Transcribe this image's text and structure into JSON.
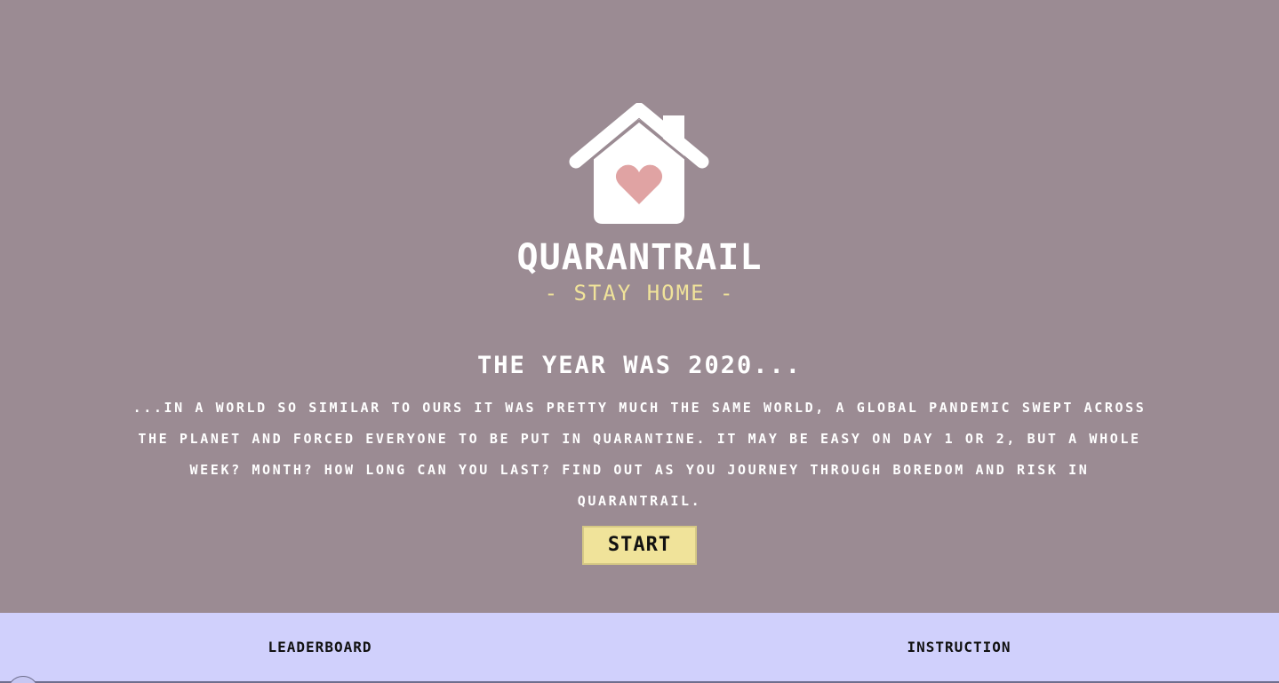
{
  "colors": {
    "background": "#9b8b93",
    "title": "#ffffff",
    "accent_yellow": "#f0e39a",
    "heart": "#e0a3a3",
    "bottom_bar": "#d0d0fc"
  },
  "logo": {
    "icon": "house-with-heart-icon"
  },
  "header": {
    "title": "QUARANTRAIL",
    "subtitle": "- STAY HOME -"
  },
  "intro": {
    "heading": "THE YEAR WAS 2020...",
    "story": "...IN A WORLD SO SIMILAR TO OURS IT WAS PRETTY MUCH THE SAME WORLD, A GLOBAL PANDEMIC SWEPT ACROSS THE PLANET AND FORCED EVERYONE TO BE PUT IN QUARANTINE. IT MAY BE EASY ON DAY 1 OR 2, BUT A WHOLE WEEK? MONTH? HOW LONG CAN YOU LAST? FIND OUT AS YOU JOURNEY THROUGH BOREDOM AND RISK IN QUARANTRAIL."
  },
  "actions": {
    "start_label": "START"
  },
  "footer_nav": {
    "leaderboard_label": "LEADERBOARD",
    "instruction_label": "INSTRUCTION"
  }
}
